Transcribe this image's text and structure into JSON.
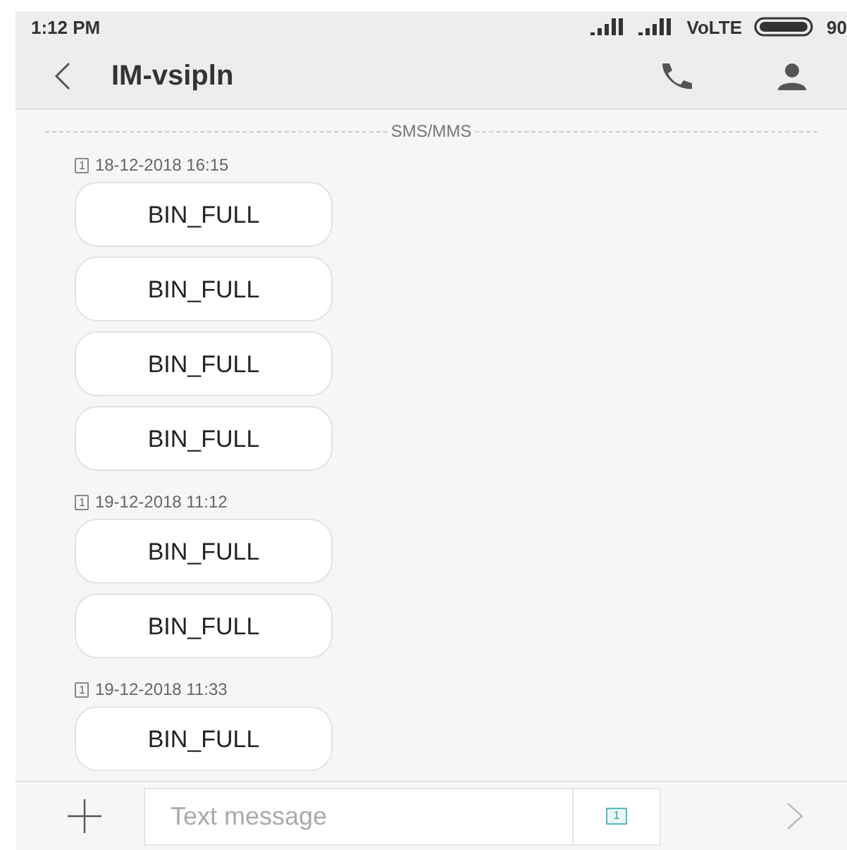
{
  "status_bar": {
    "time": "1:12 PM",
    "network": "VoLTE",
    "battery": "90"
  },
  "header": {
    "title": "IM-vsipln"
  },
  "divider_label": "SMS/MMS",
  "groups": [
    {
      "sim": "1",
      "timestamp": "18-12-2018 16:15",
      "messages": [
        "BIN_FULL",
        "BIN_FULL",
        "BIN_FULL",
        "BIN_FULL"
      ]
    },
    {
      "sim": "1",
      "timestamp": "19-12-2018 11:12",
      "messages": [
        "BIN_FULL",
        "BIN_FULL"
      ]
    },
    {
      "sim": "1",
      "timestamp": "19-12-2018 11:33",
      "messages": [
        "BIN_FULL"
      ]
    }
  ],
  "composer": {
    "placeholder": "Text message",
    "sim": "1"
  }
}
